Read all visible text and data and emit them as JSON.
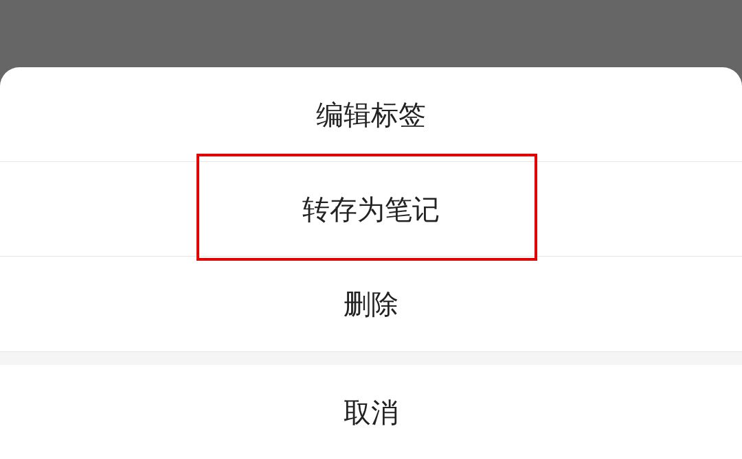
{
  "action_sheet": {
    "items": [
      {
        "label": "编辑标签",
        "highlighted": false
      },
      {
        "label": "转存为笔记",
        "highlighted": true
      },
      {
        "label": "删除",
        "highlighted": false
      }
    ],
    "cancel": {
      "label": "取消"
    }
  }
}
